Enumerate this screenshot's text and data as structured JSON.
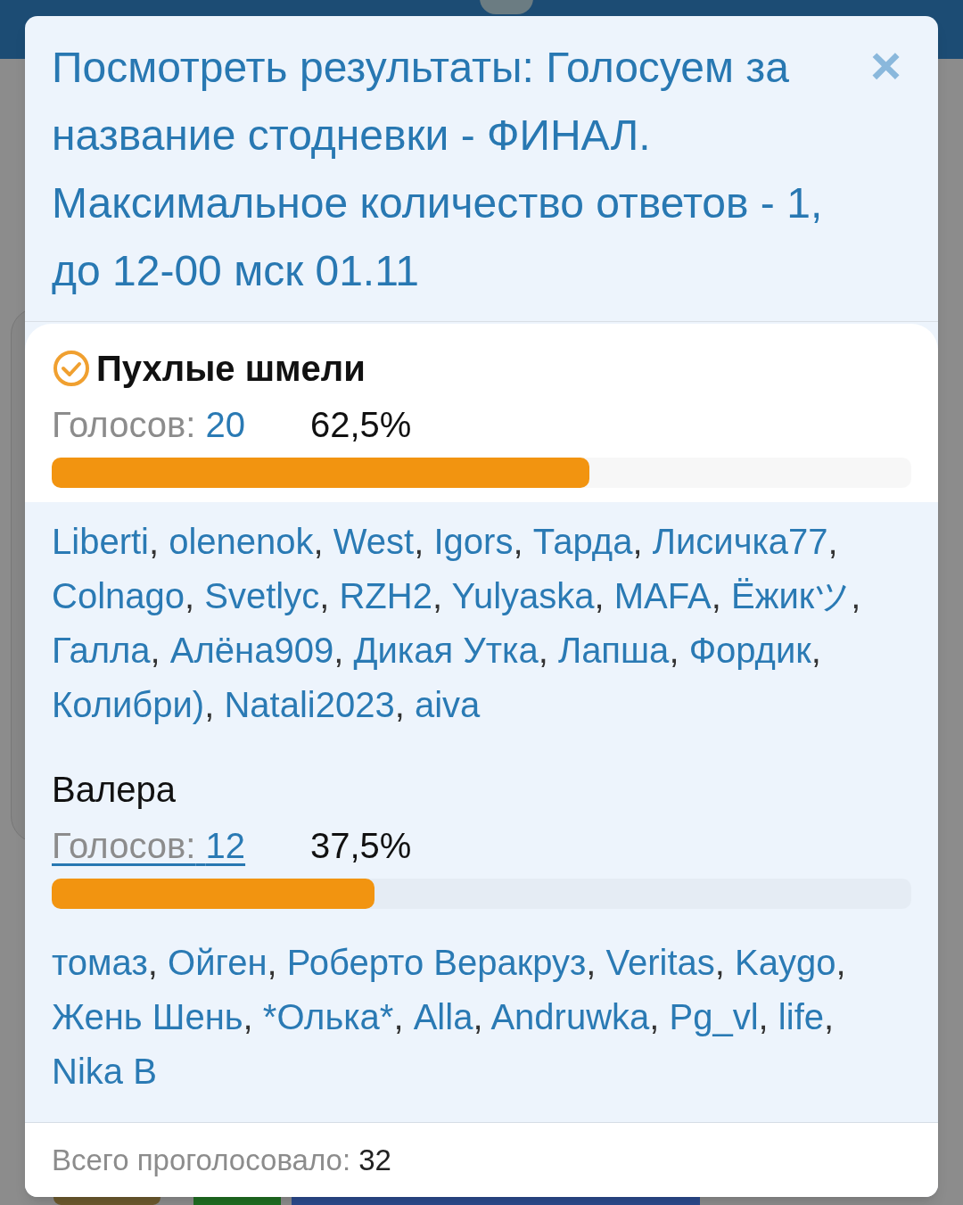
{
  "dialog": {
    "title": "Посмотреть результаты: Голосуем за название стодневки - ФИНАЛ. Максимальное количество ответов - 1, до 12-00 мск 01.11",
    "close": "×"
  },
  "options": [
    {
      "name": "Пухлые шмели",
      "selected": true,
      "votes_label": "Голосов:",
      "votes": "20",
      "underlined": false,
      "percent": "62,5%",
      "level": 0.625,
      "separator": ",",
      "voters": [
        "Liberti",
        "olenenok",
        "West",
        "Igors",
        "Тарда",
        "Лисичка77",
        "Colnago",
        "Svetlyc",
        "RZH2",
        "Yulyaska",
        "MAFA",
        "Ёжикツ",
        "Галла",
        "Алёна909",
        "Дикая Утка",
        "Лапша",
        "Фордик",
        "Колибри)",
        "Natali2023",
        "aiva"
      ]
    },
    {
      "name": "Валера",
      "selected": false,
      "votes_label": "Голосов:",
      "votes": "12",
      "underlined": true,
      "percent": "37,5%",
      "level": 0.375,
      "separator": ",",
      "voters": [
        "томаз",
        "Ойген",
        "Роберто Веракруз",
        "Veritas",
        "Kaygo",
        "Жень Шень",
        "*Олька*",
        "Alla",
        "Andruwka",
        "Pg_vl",
        "life",
        "Nika B"
      ]
    }
  ],
  "footer": {
    "label": "Всего проголосовало:",
    "total": "32"
  }
}
